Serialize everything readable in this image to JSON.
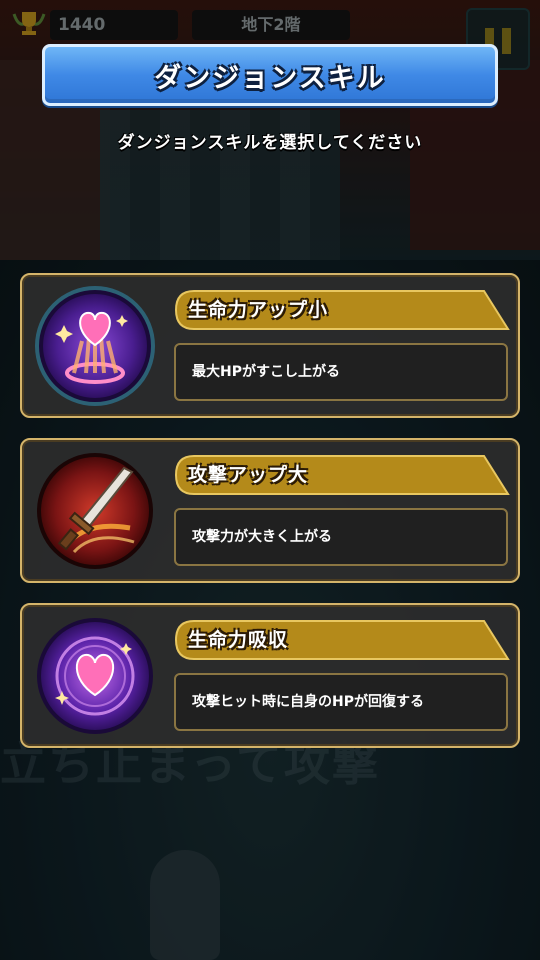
{
  "hud": {
    "score": "1440",
    "floor": "地下2階",
    "trophy_icon": "trophy-icon",
    "pause_icon": "pause-icon"
  },
  "background": {
    "faded_text": "立ち止まって攻撃"
  },
  "dialog": {
    "title": "ダンジョンスキル",
    "subtitle": "ダンジョンスキルを選択してください"
  },
  "skills": [
    {
      "name": "生命力アップ小",
      "description": "最大HPがすこし上がる",
      "icon": "heart-aura-icon",
      "color": "#5b2aa8"
    },
    {
      "name": "攻撃アップ大",
      "description": "攻撃力が大きく上がる",
      "icon": "sword-icon",
      "color": "#9b1e1e"
    },
    {
      "name": "生命力吸収",
      "description": "攻撃ヒット時に自身のHPが回復する",
      "icon": "heart-drain-icon",
      "color": "#6a2ab0"
    }
  ],
  "colors": {
    "title_blue": "#3f89e6",
    "card_border": "#d4b46a",
    "name_bar": "#b48a1a"
  }
}
